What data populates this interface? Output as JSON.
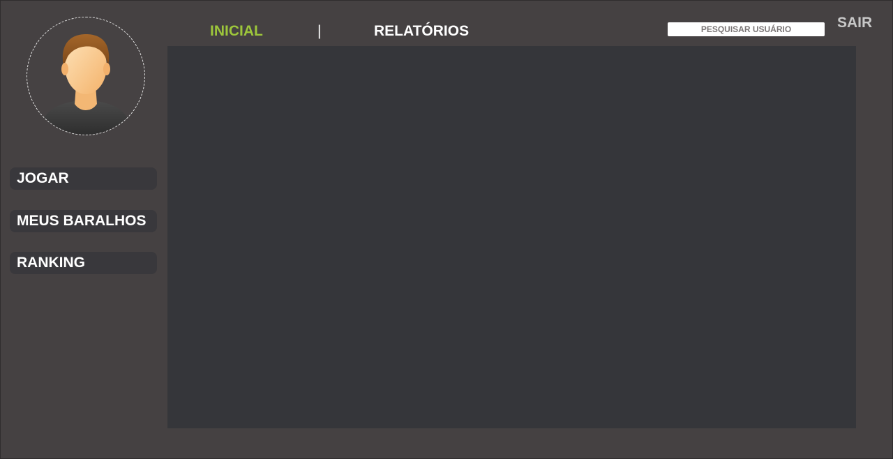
{
  "nav": {
    "home_label": "INICIAL",
    "separator": "|",
    "reports_label": "RELATÓRIOS",
    "active_color": "#9dc63b"
  },
  "search": {
    "placeholder": "PESQUISAR USUÁRIO",
    "value": ""
  },
  "logout_label": "SAIR",
  "profile": {
    "avatar_icon": "user-avatar-icon"
  },
  "sidebar": {
    "items": [
      {
        "label": "JOGAR"
      },
      {
        "label": "MEUS BARALHOS"
      },
      {
        "label": "RANKING"
      }
    ]
  },
  "colors": {
    "background": "#454142",
    "panel": "#35363a",
    "menu_button": "#39383c"
  }
}
